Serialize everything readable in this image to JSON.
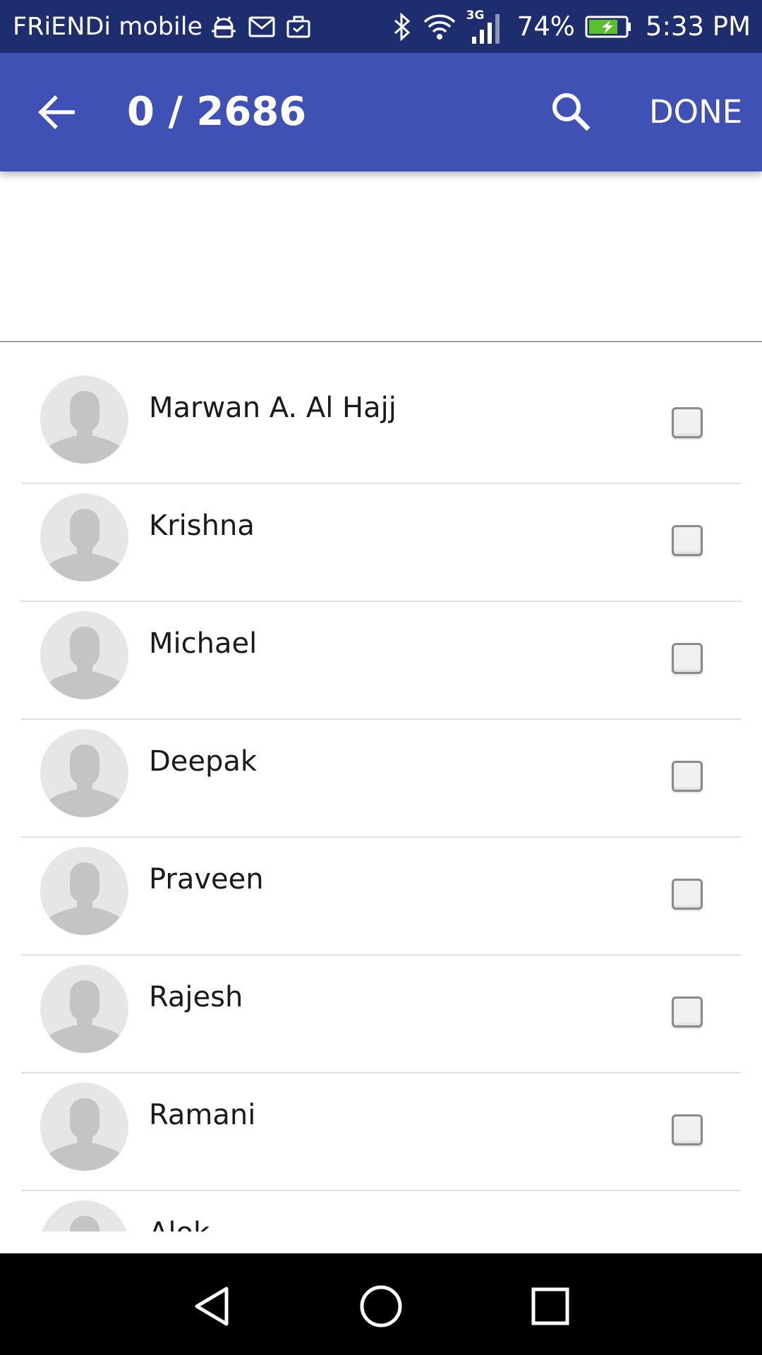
{
  "status_bar": {
    "carrier": "FRiENDi mobile",
    "notification_icons": [
      "android-debug-icon",
      "gmail-icon",
      "briefcase-icon"
    ],
    "network_type": "3G",
    "battery_percent": "74%",
    "time": "5:33 PM"
  },
  "app_bar": {
    "selection_count": "0 / 2686",
    "done_label": "DONE",
    "background_color": "#3f51b5"
  },
  "contacts": [
    {
      "name": "Marwan A. Al Hajj",
      "checked": false
    },
    {
      "name": "Krishna",
      "checked": false
    },
    {
      "name": "Michael",
      "checked": false
    },
    {
      "name": "Deepak",
      "checked": false
    },
    {
      "name": "Praveen",
      "checked": false
    },
    {
      "name": "Rajesh",
      "checked": false
    },
    {
      "name": "Ramani",
      "checked": false
    },
    {
      "name": "Alok",
      "checked": false
    }
  ],
  "navigation_bar": {
    "buttons": [
      "back-nav-icon",
      "home-nav-icon",
      "recents-nav-icon"
    ]
  }
}
